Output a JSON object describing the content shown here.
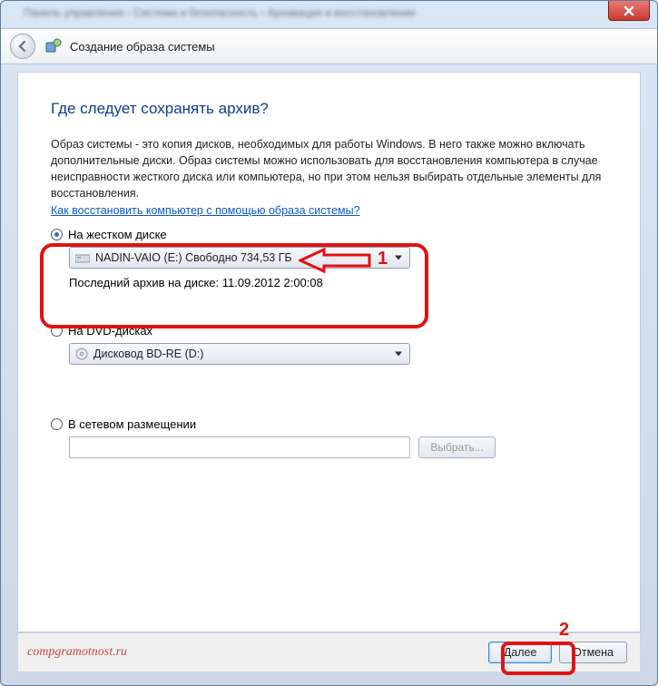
{
  "breadcrumb": "Панель управления  ›  Система и безопасность  ›  Архивация и восстановление",
  "header": {
    "title": "Создание образа системы"
  },
  "main_heading": "Где следует сохранять архив?",
  "description": "Образ системы - это копия дисков, необходимых для работы Windows. В него также можно включать дополнительные диски. Образ системы можно использовать для восстановления компьютера в случае неисправности жесткого диска или компьютера, но при этом нельзя выбирать отдельные элементы для восстановления.",
  "help_link": "Как восстановить компьютер с помощью образа системы?",
  "option_hdd": {
    "label": "На жестком диске",
    "drive": "NADIN-VAIO (E:)  Свободно 734,53 ГБ",
    "last_label": "Последний архив на диске:",
    "last_value": "11.09.2012 2:00:08",
    "selected": true
  },
  "option_dvd": {
    "label": "На DVD-дисках",
    "drive": "Дисковод BD-RE (D:)",
    "selected": false
  },
  "option_net": {
    "label": "В сетевом размещении",
    "browse": "Выбрать...",
    "selected": false
  },
  "footer": {
    "next": "Далее",
    "cancel": "Отмена"
  },
  "watermark": "compgramotnost.ru",
  "annotations": {
    "n1": "1",
    "n2": "2"
  }
}
